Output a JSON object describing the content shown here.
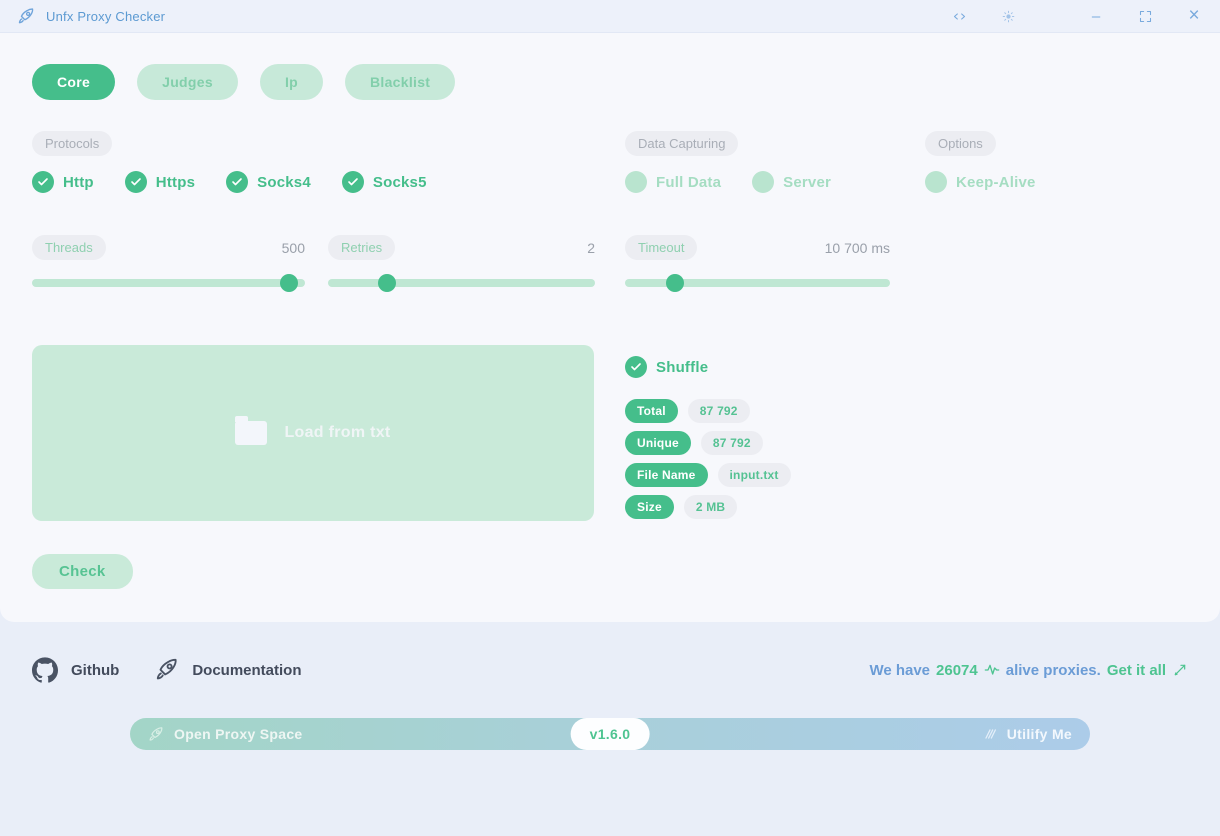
{
  "titlebar": {
    "title": "Unfx Proxy Checker",
    "icons": [
      "rocket-logo",
      "code",
      "theme-sun",
      "minimize",
      "maximize",
      "close"
    ],
    "minimize_glyph": "–",
    "close_glyph": "×"
  },
  "tabs": [
    {
      "label": "Core",
      "active": true
    },
    {
      "label": "Judges",
      "active": false
    },
    {
      "label": "Ip",
      "active": false
    },
    {
      "label": "Blacklist",
      "active": false
    }
  ],
  "sections": {
    "protocols": {
      "label": "Protocols",
      "items": [
        {
          "label": "Http",
          "checked": true
        },
        {
          "label": "Https",
          "checked": true
        },
        {
          "label": "Socks4",
          "checked": true
        },
        {
          "label": "Socks5",
          "checked": true
        }
      ]
    },
    "data_capturing": {
      "label": "Data Capturing",
      "items": [
        {
          "label": "Full Data",
          "checked": false
        },
        {
          "label": "Server",
          "checked": false
        }
      ]
    },
    "options": {
      "label": "Options",
      "items": [
        {
          "label": "Keep-Alive",
          "checked": false
        }
      ]
    }
  },
  "sliders": [
    {
      "label": "Threads",
      "value": "500",
      "percent": 94
    },
    {
      "label": "Retries",
      "value": "2",
      "percent": 22
    },
    {
      "label": "Timeout",
      "value": "10 700 ms",
      "percent": 19
    }
  ],
  "dropzone": {
    "label": "Load from txt",
    "icon": "folder"
  },
  "shuffle": {
    "label": "Shuffle",
    "checked": true
  },
  "stats": [
    {
      "key": "Total",
      "value": "87 792"
    },
    {
      "key": "Unique",
      "value": "87 792"
    },
    {
      "key": "File Name",
      "value": "input.txt"
    },
    {
      "key": "Size",
      "value": "2 MB"
    }
  ],
  "check_button": {
    "label": "Check"
  },
  "footer": {
    "github_label": "Github",
    "documentation_label": "Documentation",
    "message": {
      "prefix": "We have",
      "count": "26074",
      "middle": "alive proxies.",
      "cta": "Get it all"
    }
  },
  "bottom_bar": {
    "left_label": "Open Proxy Space",
    "version": "v1.6.0",
    "right_label": "Utilify Me"
  },
  "colors": {
    "accent_green": "#45be8b",
    "light_green": "#c7e9d9",
    "inactive_green_text": "#82cfab",
    "title_blue": "#5c9ad2",
    "footer_blue": "#6b9cd6",
    "footer_green": "#4ec491",
    "pill_gray_bg": "#ecedf2",
    "pill_gray_text": "#a9aeb7",
    "page_bg": "#e9eef8",
    "card_bg": "#f7f8fc",
    "titlebar_bg": "#edf1fa",
    "bar_gradient_left": "#a3d5c7",
    "bar_gradient_right": "#accce9"
  }
}
